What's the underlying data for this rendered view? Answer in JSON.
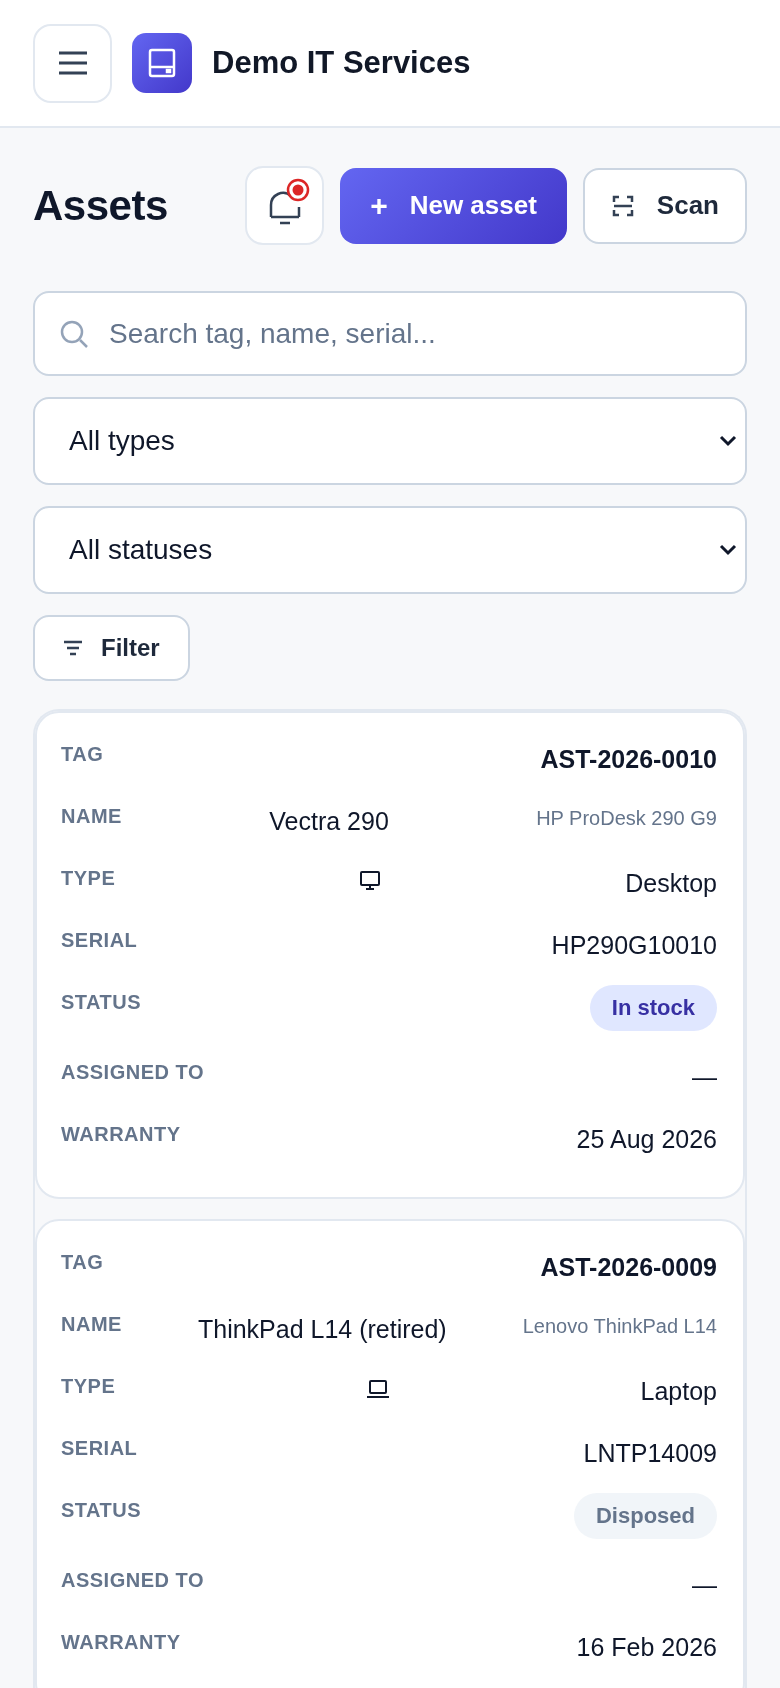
{
  "header": {
    "brand": "Demo IT Services"
  },
  "page": {
    "title": "Assets",
    "notifications_unread": true,
    "new_button": "+",
    "new_label": "New asset",
    "scan_label": "Scan"
  },
  "search": {
    "placeholder": "Search tag, name, serial..."
  },
  "filters": [
    {
      "value": "All types"
    },
    {
      "value": "All statuses"
    }
  ],
  "filter_button": "Filter",
  "assets": [
    {
      "tag_label": "TAG",
      "tag": "AST-2026-0010",
      "name_label": "NAME",
      "name": "Vectra 290",
      "model": "HP ProDesk 290 G9",
      "type_label": "TYPE",
      "type": {
        "label": "Desktop",
        "kind": "desktop"
      },
      "serial_label": "SERIAL",
      "serial": "HP290G10010",
      "status_label": "STATUS",
      "status": {
        "label": "In stock",
        "kind": "in_stock"
      },
      "assigned_label": "ASSIGNED TO",
      "assigned": "—",
      "warranty_label": "WARRANTY",
      "warranty": "25 Aug 2026"
    },
    {
      "tag_label": "TAG",
      "tag": "AST-2026-0009",
      "name_label": "NAME",
      "name": "ThinkPad L14 (retired)",
      "model": "Lenovo ThinkPad L14",
      "type_label": "TYPE",
      "type": {
        "label": "Laptop",
        "kind": "laptop"
      },
      "serial_label": "SERIAL",
      "serial": "LNTP14009",
      "status_label": "STATUS",
      "status": {
        "label": "Disposed",
        "kind": "disposed"
      },
      "assigned_label": "ASSIGNED TO",
      "assigned": "—",
      "warranty_label": "WARRANTY",
      "warranty": "16 Feb 2026"
    }
  ]
}
